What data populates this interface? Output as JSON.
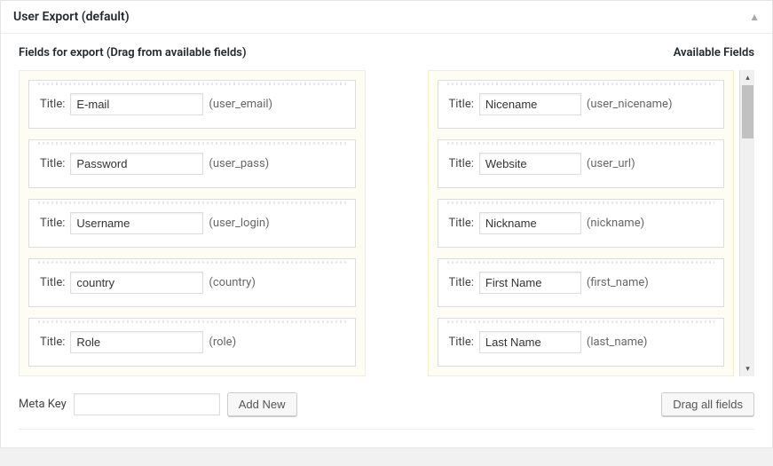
{
  "panel": {
    "title": "User Export (default)"
  },
  "headings": {
    "left": "Fields for export (Drag from available fields)",
    "right": "Available Fields"
  },
  "field_label": "Title:",
  "export_fields": [
    {
      "title": "E-mail",
      "slug": "(user_email)"
    },
    {
      "title": "Password",
      "slug": "(user_pass)"
    },
    {
      "title": "Username",
      "slug": "(user_login)"
    },
    {
      "title": "country",
      "slug": "(country)"
    },
    {
      "title": "Role",
      "slug": "(role)"
    }
  ],
  "available_fields": [
    {
      "title": "Nicename",
      "slug": "(user_nicename)"
    },
    {
      "title": "Website",
      "slug": "(user_url)"
    },
    {
      "title": "Nickname",
      "slug": "(nickname)"
    },
    {
      "title": "First Name",
      "slug": "(first_name)"
    },
    {
      "title": "Last Name",
      "slug": "(last_name)"
    }
  ],
  "meta_key": {
    "label": "Meta Key",
    "value": "",
    "add_button": "Add New"
  },
  "drag_all_button": "Drag all fields"
}
